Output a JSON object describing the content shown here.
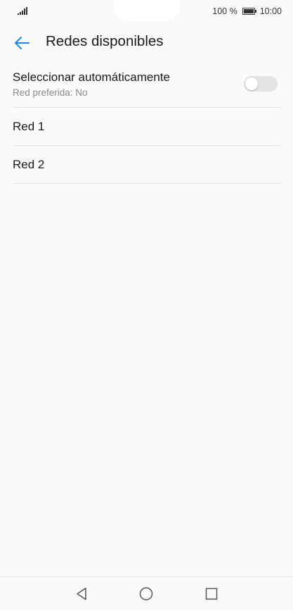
{
  "status_bar": {
    "battery_text": "100 %",
    "time": "10:00",
    "icons": [
      "signal-icon",
      "battery-icon"
    ]
  },
  "app_bar": {
    "title": "Redes disponibles",
    "back_icon": "arrow-left-icon"
  },
  "auto_select": {
    "title": "Seleccionar automáticamente",
    "subtitle": "Red preferida: No",
    "enabled": false
  },
  "networks": [
    {
      "label": "Red 1"
    },
    {
      "label": "Red 2"
    }
  ],
  "nav_bar": {
    "icons": [
      "back-triangle-icon",
      "home-circle-icon",
      "recents-square-icon"
    ]
  },
  "colors": {
    "accent": "#1e88e5",
    "background": "#fafafa",
    "divider": "#e3e3e3",
    "secondary_text": "#8a8a8a",
    "toggle_off": "#e4e4e4"
  }
}
